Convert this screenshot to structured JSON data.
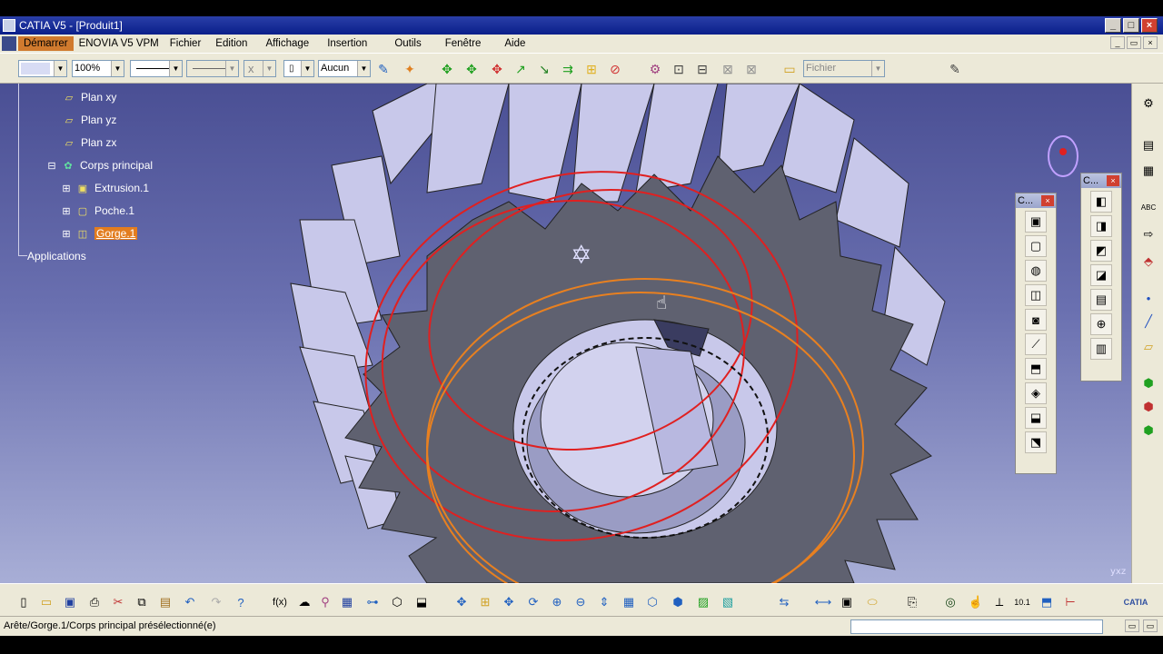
{
  "window": {
    "title": "CATIA V5 - [Produit1]"
  },
  "menu": {
    "items": [
      "Démarrer",
      "ENOVIA V5 VPM",
      "Fichier",
      "Edition",
      "Affichage",
      "Insertion",
      "Outils",
      "Fenêtre",
      "Aide"
    ],
    "active_index": 0
  },
  "property_toolbar": {
    "color_value": "",
    "zoom_value": "100%",
    "line_type": "",
    "line_weight": "",
    "layer_value": "Aucun",
    "filter_value": "Fichier",
    "point_value": "x"
  },
  "tree": {
    "nodes": [
      {
        "label": "Plan xy",
        "icon": "plane-icon"
      },
      {
        "label": "Plan yz",
        "icon": "plane-icon"
      },
      {
        "label": "Plan zx",
        "icon": "plane-icon"
      },
      {
        "label": "Corps principal",
        "icon": "body-icon"
      },
      {
        "label": "Extrusion.1",
        "icon": "pad-icon"
      },
      {
        "label": "Poche.1",
        "icon": "pocket-icon"
      },
      {
        "label": "Gorge.1",
        "icon": "groove-icon",
        "selected": true
      },
      {
        "label": "Applications",
        "icon": ""
      }
    ]
  },
  "floating_toolbars": [
    {
      "title": "C...",
      "icons": [
        "pad-icon",
        "pocket-icon",
        "shaft-icon",
        "groove-icon",
        "hole-icon",
        "rib-icon",
        "slot-icon",
        "solid-combine-icon",
        "stiffener-icon",
        "multi-section-icon"
      ]
    },
    {
      "title": "C...",
      "icons": [
        "fillet-icon",
        "chamfer-icon",
        "draft-icon",
        "shell-icon",
        "thickness-icon",
        "thread-icon",
        "remove-face-icon"
      ]
    }
  ],
  "status": {
    "text": "Arête/Gorge.1/Corps principal présélectionné(e)"
  },
  "colors": {
    "viewport_top": "#4a4f94",
    "viewport_bottom": "#a8aed6",
    "selection": "#e37d1f",
    "gear_face": "#5f6170",
    "gear_side": "#c8c8ea"
  }
}
